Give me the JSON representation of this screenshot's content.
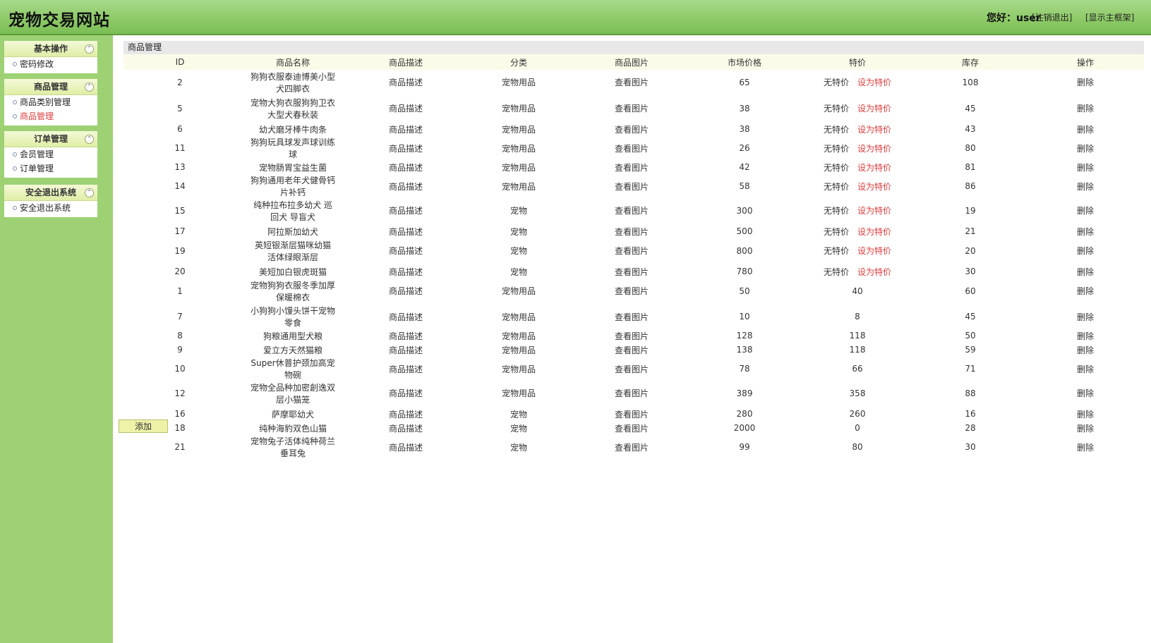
{
  "header": {
    "site_title": "宠物交易网站",
    "greeting": "您好：user",
    "logout_link": "[注销退出]",
    "main_frame_link": "[显示主框架]"
  },
  "sidebar": {
    "groups": [
      {
        "title": "基本操作",
        "items": [
          {
            "label": "密码修改"
          }
        ]
      },
      {
        "title": "商品管理",
        "items": [
          {
            "label": "商品类别管理"
          },
          {
            "label": "商品管理"
          }
        ]
      },
      {
        "title": "订单管理",
        "items": [
          {
            "label": "会员管理"
          },
          {
            "label": "订单管理"
          }
        ]
      },
      {
        "title": "安全退出系统",
        "items": [
          {
            "label": "安全退出系统"
          }
        ]
      }
    ],
    "collapse_icon": "double-chevron-up-icon"
  },
  "main": {
    "panel_title": "商品管理",
    "columns": [
      "ID",
      "商品名称",
      "商品描述",
      "分类",
      "商品图片",
      "市场价格",
      "特价",
      "库存",
      "操作"
    ],
    "rows": [
      {
        "id": "2",
        "name": "狗狗衣服泰迪博美小型犬四脚衣",
        "desc": "商品描述",
        "category": "宠物用品",
        "pic": "查看图片",
        "price": "65",
        "special": "无特价",
        "set_special": "设为特价",
        "stock": "108",
        "action": "删除"
      },
      {
        "id": "5",
        "name": "宠物大狗衣服狗狗卫衣大型犬春秋装",
        "desc": "商品描述",
        "category": "宠物用品",
        "pic": "查看图片",
        "price": "38",
        "special": "无特价",
        "set_special": "设为特价",
        "stock": "45",
        "action": "删除"
      },
      {
        "id": "6",
        "name": "幼犬磨牙棒牛肉条",
        "desc": "商品描述",
        "category": "宠物用品",
        "pic": "查看图片",
        "price": "38",
        "special": "无特价",
        "set_special": "设为特价",
        "stock": "43",
        "action": "删除"
      },
      {
        "id": "11",
        "name": "狗狗玩具球发声球训练球",
        "desc": "商品描述",
        "category": "宠物用品",
        "pic": "查看图片",
        "price": "26",
        "special": "无特价",
        "set_special": "设为特价",
        "stock": "80",
        "action": "删除"
      },
      {
        "id": "13",
        "name": "宠物肠胃宝益生菌",
        "desc": "商品描述",
        "category": "宠物用品",
        "pic": "查看图片",
        "price": "42",
        "special": "无特价",
        "set_special": "设为特价",
        "stock": "81",
        "action": "删除"
      },
      {
        "id": "14",
        "name": "狗狗通用老年犬健骨钙片补钙",
        "desc": "商品描述",
        "category": "宠物用品",
        "pic": "查看图片",
        "price": "58",
        "special": "无特价",
        "set_special": "设为特价",
        "stock": "86",
        "action": "删除"
      },
      {
        "id": "15",
        "name": "纯种拉布拉多幼犬 巡回犬 导盲犬",
        "desc": "商品描述",
        "category": "宠物",
        "pic": "查看图片",
        "price": "300",
        "special": "无特价",
        "set_special": "设为特价",
        "stock": "19",
        "action": "删除"
      },
      {
        "id": "17",
        "name": "阿拉斯加幼犬",
        "desc": "商品描述",
        "category": "宠物",
        "pic": "查看图片",
        "price": "500",
        "special": "无特价",
        "set_special": "设为特价",
        "stock": "21",
        "action": "删除"
      },
      {
        "id": "19",
        "name": "英短银渐层猫咪幼猫 活体绿眼渐层",
        "desc": "商品描述",
        "category": "宠物",
        "pic": "查看图片",
        "price": "800",
        "special": "无特价",
        "set_special": "设为特价",
        "stock": "20",
        "action": "删除"
      },
      {
        "id": "20",
        "name": "美短加白银虎斑猫",
        "desc": "商品描述",
        "category": "宠物",
        "pic": "查看图片",
        "price": "780",
        "special": "无特价",
        "set_special": "设为特价",
        "stock": "30",
        "action": "删除"
      },
      {
        "id": "1",
        "name": "宠物狗狗衣服冬季加厚保暖棉衣",
        "desc": "商品描述",
        "category": "宠物用品",
        "pic": "查看图片",
        "price": "50",
        "special": "40",
        "set_special": "",
        "stock": "60",
        "action": "删除"
      },
      {
        "id": "7",
        "name": "小狗狗小馒头饼干宠物零食",
        "desc": "商品描述",
        "category": "宠物用品",
        "pic": "查看图片",
        "price": "10",
        "special": "8",
        "set_special": "",
        "stock": "45",
        "action": "删除"
      },
      {
        "id": "8",
        "name": "狗粮通用型犬粮",
        "desc": "商品描述",
        "category": "宠物用品",
        "pic": "查看图片",
        "price": "128",
        "special": "118",
        "set_special": "",
        "stock": "50",
        "action": "删除"
      },
      {
        "id": "9",
        "name": "爱立方天然猫粮",
        "desc": "商品描述",
        "category": "宠物用品",
        "pic": "查看图片",
        "price": "138",
        "special": "118",
        "set_special": "",
        "stock": "59",
        "action": "删除"
      },
      {
        "id": "10",
        "name": "Super休普护颈加高宠物碗",
        "desc": "商品描述",
        "category": "宠物用品",
        "pic": "查看图片",
        "price": "78",
        "special": "66",
        "set_special": "",
        "stock": "71",
        "action": "删除"
      },
      {
        "id": "12",
        "name": "宠物全品种加密創逸双层小猫笼",
        "desc": "商品描述",
        "category": "宠物用品",
        "pic": "查看图片",
        "price": "389",
        "special": "358",
        "set_special": "",
        "stock": "88",
        "action": "删除"
      },
      {
        "id": "16",
        "name": "萨摩耶幼犬",
        "desc": "商品描述",
        "category": "宠物",
        "pic": "查看图片",
        "price": "280",
        "special": "260",
        "set_special": "",
        "stock": "16",
        "action": "删除"
      },
      {
        "id": "18",
        "name": "纯种海豹双色山猫",
        "desc": "商品描述",
        "category": "宠物",
        "pic": "查看图片",
        "price": "2000",
        "special": "0",
        "set_special": "",
        "stock": "28",
        "action": "删除"
      },
      {
        "id": "21",
        "name": "宠物兔子活体纯种荷兰垂耳兔",
        "desc": "商品描述",
        "category": "宠物",
        "pic": "查看图片",
        "price": "99",
        "special": "80",
        "set_special": "",
        "stock": "30",
        "action": "删除"
      }
    ],
    "add_button": "添加"
  }
}
